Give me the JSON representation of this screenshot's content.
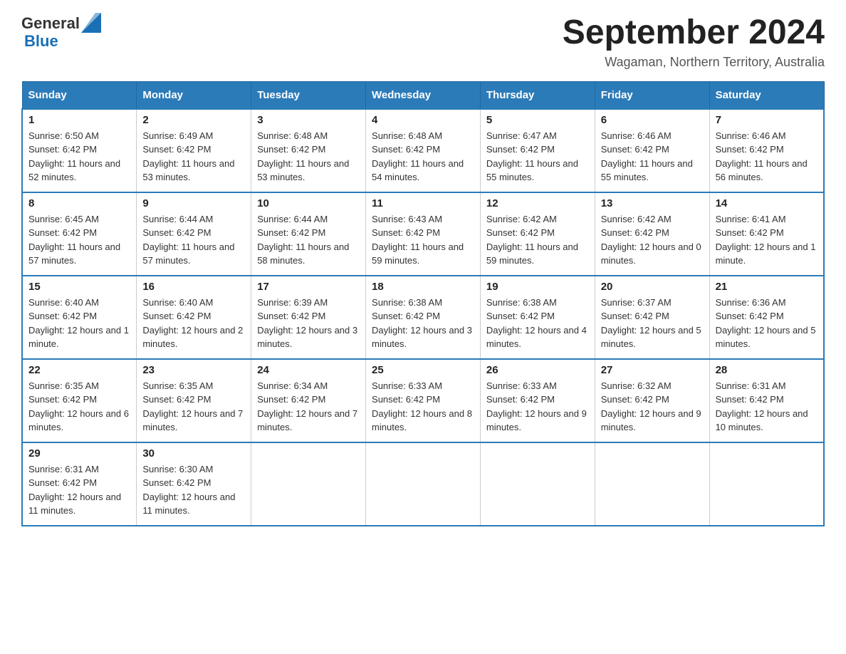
{
  "header": {
    "logo_general": "General",
    "logo_blue": "Blue",
    "month_title": "September 2024",
    "location": "Wagaman, Northern Territory, Australia"
  },
  "days_of_week": [
    "Sunday",
    "Monday",
    "Tuesday",
    "Wednesday",
    "Thursday",
    "Friday",
    "Saturday"
  ],
  "weeks": [
    [
      {
        "day": "1",
        "sunrise": "Sunrise: 6:50 AM",
        "sunset": "Sunset: 6:42 PM",
        "daylight": "Daylight: 11 hours and 52 minutes."
      },
      {
        "day": "2",
        "sunrise": "Sunrise: 6:49 AM",
        "sunset": "Sunset: 6:42 PM",
        "daylight": "Daylight: 11 hours and 53 minutes."
      },
      {
        "day": "3",
        "sunrise": "Sunrise: 6:48 AM",
        "sunset": "Sunset: 6:42 PM",
        "daylight": "Daylight: 11 hours and 53 minutes."
      },
      {
        "day": "4",
        "sunrise": "Sunrise: 6:48 AM",
        "sunset": "Sunset: 6:42 PM",
        "daylight": "Daylight: 11 hours and 54 minutes."
      },
      {
        "day": "5",
        "sunrise": "Sunrise: 6:47 AM",
        "sunset": "Sunset: 6:42 PM",
        "daylight": "Daylight: 11 hours and 55 minutes."
      },
      {
        "day": "6",
        "sunrise": "Sunrise: 6:46 AM",
        "sunset": "Sunset: 6:42 PM",
        "daylight": "Daylight: 11 hours and 55 minutes."
      },
      {
        "day": "7",
        "sunrise": "Sunrise: 6:46 AM",
        "sunset": "Sunset: 6:42 PM",
        "daylight": "Daylight: 11 hours and 56 minutes."
      }
    ],
    [
      {
        "day": "8",
        "sunrise": "Sunrise: 6:45 AM",
        "sunset": "Sunset: 6:42 PM",
        "daylight": "Daylight: 11 hours and 57 minutes."
      },
      {
        "day": "9",
        "sunrise": "Sunrise: 6:44 AM",
        "sunset": "Sunset: 6:42 PM",
        "daylight": "Daylight: 11 hours and 57 minutes."
      },
      {
        "day": "10",
        "sunrise": "Sunrise: 6:44 AM",
        "sunset": "Sunset: 6:42 PM",
        "daylight": "Daylight: 11 hours and 58 minutes."
      },
      {
        "day": "11",
        "sunrise": "Sunrise: 6:43 AM",
        "sunset": "Sunset: 6:42 PM",
        "daylight": "Daylight: 11 hours and 59 minutes."
      },
      {
        "day": "12",
        "sunrise": "Sunrise: 6:42 AM",
        "sunset": "Sunset: 6:42 PM",
        "daylight": "Daylight: 11 hours and 59 minutes."
      },
      {
        "day": "13",
        "sunrise": "Sunrise: 6:42 AM",
        "sunset": "Sunset: 6:42 PM",
        "daylight": "Daylight: 12 hours and 0 minutes."
      },
      {
        "day": "14",
        "sunrise": "Sunrise: 6:41 AM",
        "sunset": "Sunset: 6:42 PM",
        "daylight": "Daylight: 12 hours and 1 minute."
      }
    ],
    [
      {
        "day": "15",
        "sunrise": "Sunrise: 6:40 AM",
        "sunset": "Sunset: 6:42 PM",
        "daylight": "Daylight: 12 hours and 1 minute."
      },
      {
        "day": "16",
        "sunrise": "Sunrise: 6:40 AM",
        "sunset": "Sunset: 6:42 PM",
        "daylight": "Daylight: 12 hours and 2 minutes."
      },
      {
        "day": "17",
        "sunrise": "Sunrise: 6:39 AM",
        "sunset": "Sunset: 6:42 PM",
        "daylight": "Daylight: 12 hours and 3 minutes."
      },
      {
        "day": "18",
        "sunrise": "Sunrise: 6:38 AM",
        "sunset": "Sunset: 6:42 PM",
        "daylight": "Daylight: 12 hours and 3 minutes."
      },
      {
        "day": "19",
        "sunrise": "Sunrise: 6:38 AM",
        "sunset": "Sunset: 6:42 PM",
        "daylight": "Daylight: 12 hours and 4 minutes."
      },
      {
        "day": "20",
        "sunrise": "Sunrise: 6:37 AM",
        "sunset": "Sunset: 6:42 PM",
        "daylight": "Daylight: 12 hours and 5 minutes."
      },
      {
        "day": "21",
        "sunrise": "Sunrise: 6:36 AM",
        "sunset": "Sunset: 6:42 PM",
        "daylight": "Daylight: 12 hours and 5 minutes."
      }
    ],
    [
      {
        "day": "22",
        "sunrise": "Sunrise: 6:35 AM",
        "sunset": "Sunset: 6:42 PM",
        "daylight": "Daylight: 12 hours and 6 minutes."
      },
      {
        "day": "23",
        "sunrise": "Sunrise: 6:35 AM",
        "sunset": "Sunset: 6:42 PM",
        "daylight": "Daylight: 12 hours and 7 minutes."
      },
      {
        "day": "24",
        "sunrise": "Sunrise: 6:34 AM",
        "sunset": "Sunset: 6:42 PM",
        "daylight": "Daylight: 12 hours and 7 minutes."
      },
      {
        "day": "25",
        "sunrise": "Sunrise: 6:33 AM",
        "sunset": "Sunset: 6:42 PM",
        "daylight": "Daylight: 12 hours and 8 minutes."
      },
      {
        "day": "26",
        "sunrise": "Sunrise: 6:33 AM",
        "sunset": "Sunset: 6:42 PM",
        "daylight": "Daylight: 12 hours and 9 minutes."
      },
      {
        "day": "27",
        "sunrise": "Sunrise: 6:32 AM",
        "sunset": "Sunset: 6:42 PM",
        "daylight": "Daylight: 12 hours and 9 minutes."
      },
      {
        "day": "28",
        "sunrise": "Sunrise: 6:31 AM",
        "sunset": "Sunset: 6:42 PM",
        "daylight": "Daylight: 12 hours and 10 minutes."
      }
    ],
    [
      {
        "day": "29",
        "sunrise": "Sunrise: 6:31 AM",
        "sunset": "Sunset: 6:42 PM",
        "daylight": "Daylight: 12 hours and 11 minutes."
      },
      {
        "day": "30",
        "sunrise": "Sunrise: 6:30 AM",
        "sunset": "Sunset: 6:42 PM",
        "daylight": "Daylight: 12 hours and 11 minutes."
      },
      null,
      null,
      null,
      null,
      null
    ]
  ]
}
